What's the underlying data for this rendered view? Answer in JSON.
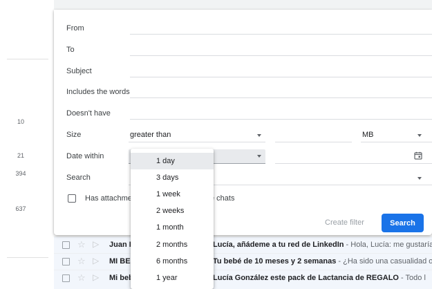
{
  "gutter": {
    "counts": [
      "10",
      "21",
      "394",
      "637"
    ]
  },
  "filter": {
    "from_label": "From",
    "to_label": "To",
    "subject_label": "Subject",
    "includes_label": "Includes the words",
    "doesnt_have_label": "Doesn't have",
    "size_label": "Size",
    "size_operator": "greater than",
    "size_unit": "MB",
    "date_within_label": "Date within",
    "search_label": "Search",
    "has_attachment_label": "Has attachme",
    "dont_include_chats_fragment": "e chats",
    "create_filter_label": "Create filter",
    "search_button_label": "Search"
  },
  "date_within_menu": {
    "options": [
      "1 day",
      "3 days",
      "1 week",
      "2 weeks",
      "1 month",
      "2 months",
      "6 months",
      "1 year"
    ],
    "selected": "1 day"
  },
  "emails": [
    {
      "sender": "Juan L",
      "subject": "Lucía, añádeme a tu red de LinkedIn",
      "snippet": " - Hola, Lucía: me gustaría añ"
    },
    {
      "sender": "MI BEB",
      "subject": "Tu bebé de 10 meses y 2 semanas",
      "snippet": " - ¿Ha sido una casualidad o"
    },
    {
      "sender": "Mi beb",
      "subject": "Lucía González este pack de Lactancia de REGALO",
      "snippet": " - Todo l"
    }
  ],
  "colors": {
    "accent": "#1a73e8",
    "selected_bg": "#e8eaed",
    "disabled_text": "#9aa0a6"
  },
  "icons": {
    "checkbox": "checkbox-icon",
    "star": "star-icon",
    "important": "important-marker-icon",
    "calendar": "calendar-icon",
    "dropdown": "caret-down-icon"
  }
}
